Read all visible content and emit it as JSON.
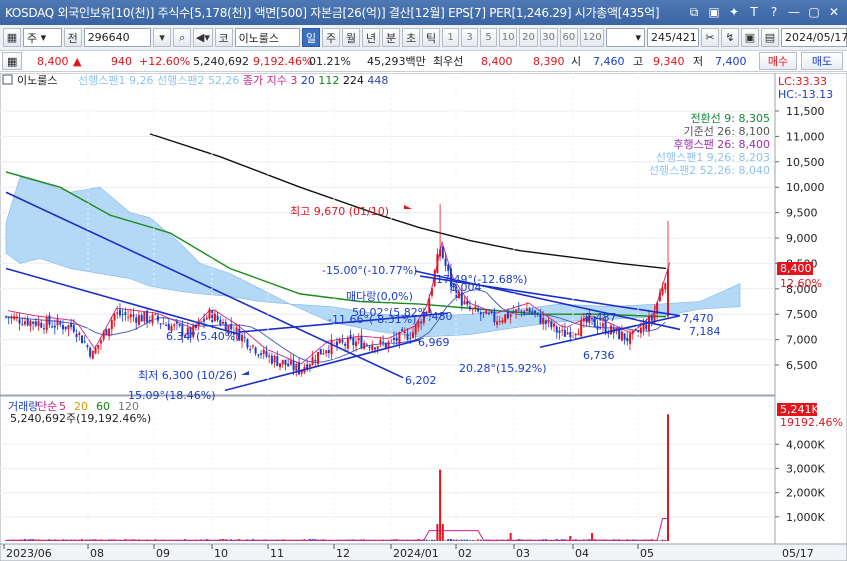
{
  "titlebar": {
    "text": "KOSDAQ 외국인보유[10(천)] 주식수[5,178(천)] 액면[500] 자본금[26(억)] 결산[12월] EPS[7] PER[1,246.29] 시가총액[435억]",
    "buttons": [
      "⧉",
      "▣",
      "✦",
      "T",
      "?",
      "—",
      "▢",
      "✕"
    ]
  },
  "toolbar": {
    "mode_select": "주",
    "prev_label": "전",
    "code_value": "296640",
    "market_label": "코",
    "stock_name": "이노룰스",
    "period_buttons": [
      "일",
      "주",
      "월",
      "년",
      "분",
      "초",
      "틱"
    ],
    "active_period": "일",
    "interval_buttons": [
      "1",
      "3",
      "5",
      "10",
      "20",
      "30",
      "60",
      "120"
    ],
    "count_value": "245",
    "count_total": "/421",
    "date_value": "2024/05/17"
  },
  "pricebar": {
    "price": "8,400",
    "change_arrow": "▲",
    "change": "940",
    "change_pct": "+12.60%",
    "volume": "5,240,692",
    "volume_pct": "9,192.46%",
    "turnover": "01.21%",
    "amount": "45,293백만",
    "quote_label": "최우선",
    "ask": "8,400",
    "bid": "8,390",
    "open_label": "시",
    "open": "7,460",
    "high_label": "고",
    "high": "9,340",
    "low_label": "저",
    "low": "7,400",
    "buy_label": "매수",
    "sell_label": "매도"
  },
  "price_panel": {
    "stock_tag": "이노룰스",
    "legend": [
      {
        "label": "선행스팬1 9,26",
        "color": "#8fc3f0"
      },
      {
        "label": "선행스팬2 52,26",
        "color": "#8fc3f0"
      },
      {
        "label": "종가 지수 3",
        "color": "#cc2288"
      },
      {
        "label": "20",
        "color": "#1a3ccc"
      },
      {
        "label": "112",
        "color": "#118811"
      },
      {
        "label": "224",
        "color": "#111111"
      },
      {
        "label": "448",
        "color": "#3344aa"
      }
    ],
    "lc": "LC:33.33",
    "hc": "HC:-13.13",
    "y_ticks": [
      "11,500",
      "11,000",
      "10,500",
      "10,000",
      "9,500",
      "9,000",
      "8,500",
      "8,000",
      "7,500",
      "7,000",
      "6,500"
    ],
    "current_price_label": "8,400",
    "current_pct_label": "12.60%",
    "ichimoku_legend": [
      {
        "label": "전환선 9: 8,305",
        "color": "#118a3a"
      },
      {
        "label": "기준선 26: 8,100",
        "color": "#555555"
      },
      {
        "label": "후행스팬 26: 8,400",
        "color": "#9b2fb0"
      },
      {
        "label": "선행스팬1 9,26: 8,203",
        "color": "#8fc3f0"
      },
      {
        "label": "선행스팬2 52,26: 8,040",
        "color": "#8fc3f0"
      }
    ],
    "annotations": {
      "high_mark": "최고 9,670 (01/10)",
      "low_mark": "최저 6,300 (10/26)",
      "pct_a": "-15.00°(-10.77%)",
      "pct_b": "-17.49°(-12.68%)",
      "pct_c": "6.34°(5.40%)",
      "pct_d": "-11.66°(-8.31%)",
      "pct_e": "50.02°(5.82%)",
      "pct_f": "20.28°(15.92%)",
      "pct_g": "15.09°(18.46%)",
      "val_6202": "6,202",
      "val_6969": "6,969",
      "val_6736": "6,736",
      "val_7480": "7,480",
      "val_7487": "7,487",
      "val_7470": "7,470",
      "val_7184": "7,184",
      "val_8004": "8,004",
      "resist": "매다랑(0,0%)"
    }
  },
  "volume_panel": {
    "legend": [
      {
        "label": "거래량",
        "color": "#1a3ccc"
      },
      {
        "label": "단순",
        "color": "#cc2288"
      },
      {
        "label": "5",
        "color": "#cc2288"
      },
      {
        "label": "20",
        "color": "#d4a000"
      },
      {
        "label": "60",
        "color": "#118811"
      },
      {
        "label": "120",
        "color": "#777777"
      }
    ],
    "volume_value": "5,240,692주(19,192.46%)",
    "y_ticks": [
      "4,000K",
      "3,000K",
      "2,000K",
      "1,000K"
    ],
    "current_vol_label": "5,241K",
    "current_vol_pct": "19192.46%"
  },
  "x_axis": {
    "labels": [
      "2023/06",
      "08",
      "09",
      "10",
      "11",
      "12",
      "2024/01",
      "02",
      "03",
      "04",
      "05"
    ],
    "right_label": "05/17"
  },
  "chart_data": {
    "type": "candlestick",
    "price_ylim": [
      6000,
      11800
    ],
    "volume_ylim": [
      0,
      5500000
    ],
    "note_high": 9670,
    "note_low": 6300,
    "last_close": 8400
  }
}
